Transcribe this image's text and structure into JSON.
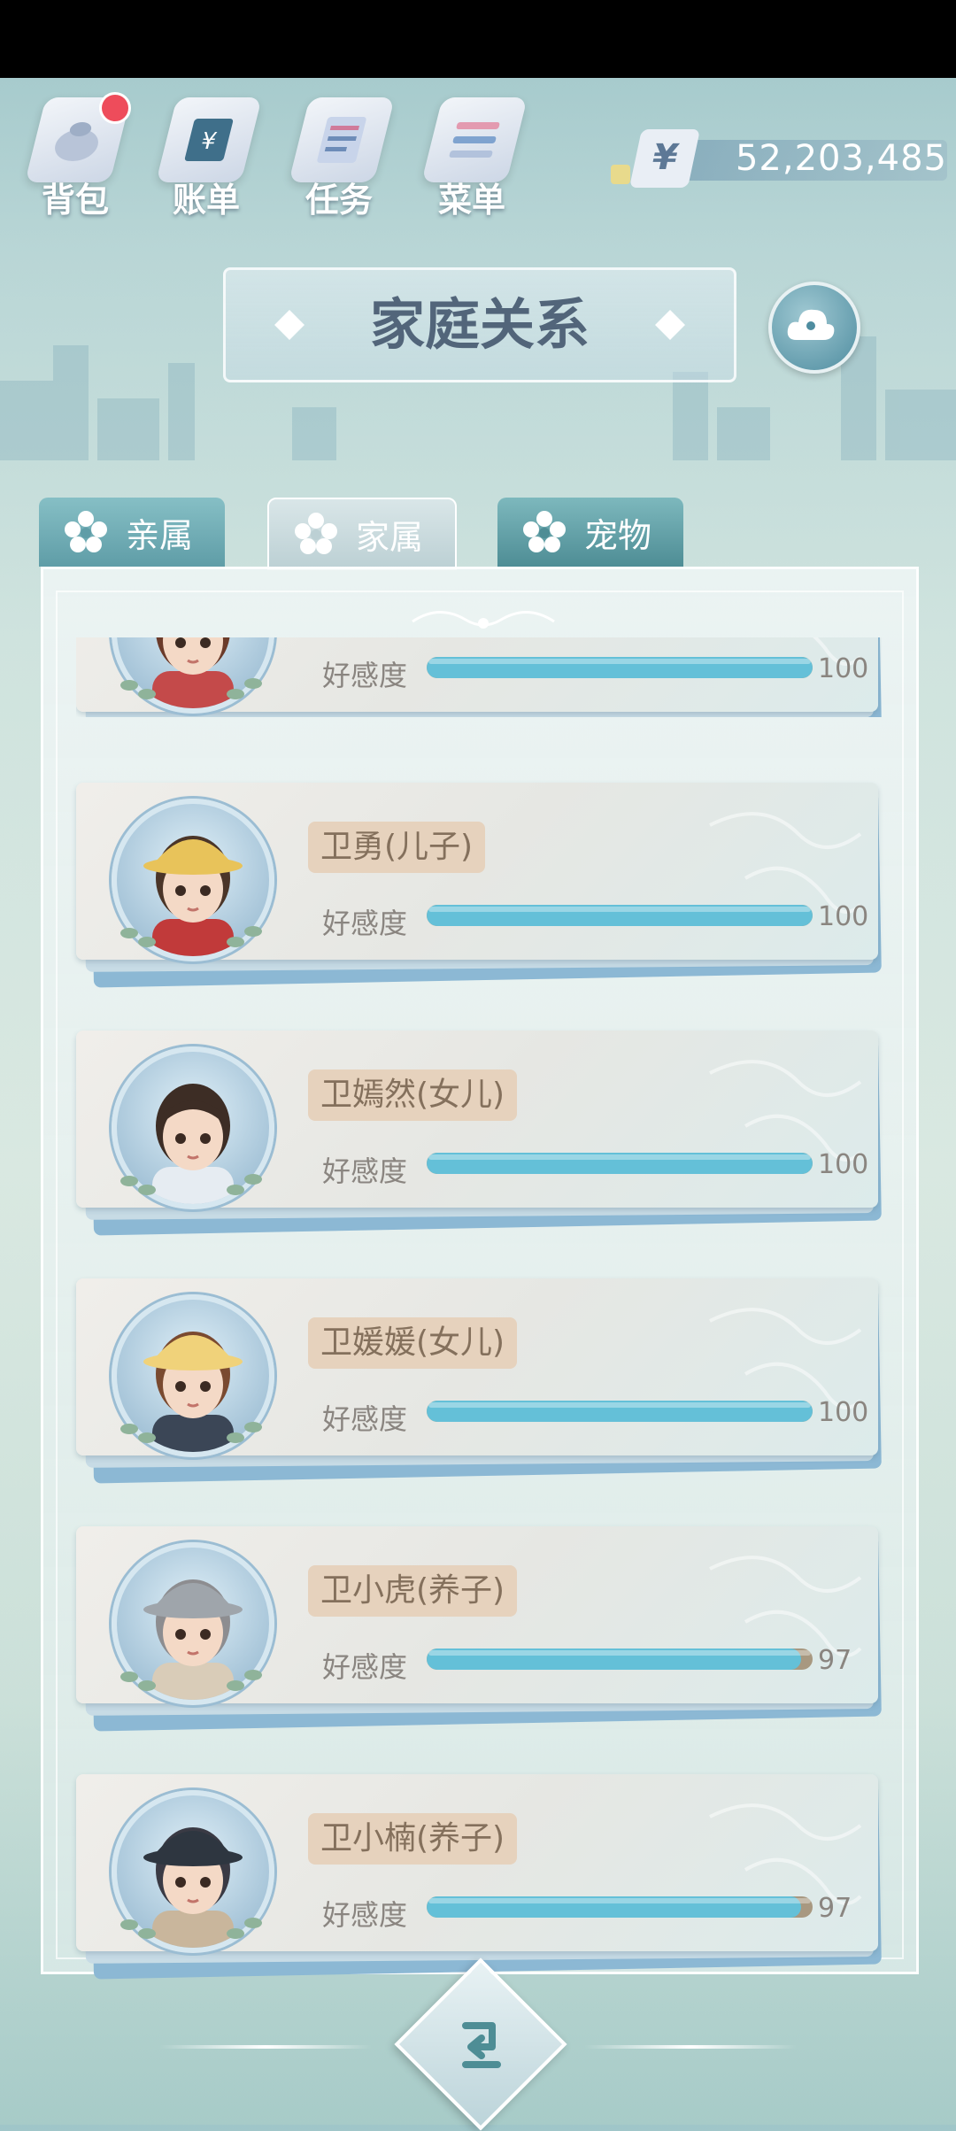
{
  "topbar": {
    "items": [
      {
        "label": "背包",
        "icon": "bag-icon",
        "badge": true
      },
      {
        "label": "账单",
        "icon": "bill-icon",
        "badge": false
      },
      {
        "label": "任务",
        "icon": "task-icon",
        "badge": false
      },
      {
        "label": "菜单",
        "icon": "menu-icon",
        "badge": false
      }
    ],
    "currency_symbol": "¥",
    "money": "52,203,485"
  },
  "title": "家庭关系",
  "tabs": [
    {
      "label": "亲属",
      "active": false
    },
    {
      "label": "家属",
      "active": true
    },
    {
      "label": "宠物",
      "active": false
    }
  ],
  "affinity_label": "好感度",
  "members": [
    {
      "name": "",
      "affinity": 100,
      "max": 100
    },
    {
      "name": "卫勇(儿子)",
      "affinity": 100,
      "max": 100
    },
    {
      "name": "卫嫣然(女儿)",
      "affinity": 100,
      "max": 100
    },
    {
      "name": "卫媛媛(女儿)",
      "affinity": 100,
      "max": 100
    },
    {
      "name": "卫小虎(养子)",
      "affinity": 97,
      "max": 100
    },
    {
      "name": "卫小楠(养子)",
      "affinity": 97,
      "max": 100
    }
  ],
  "colors": {
    "bar_fill": "#64c0d8",
    "bar_track": "#a89880",
    "name_tag": "#e6d2bd",
    "badge": "#ee4c5b"
  }
}
